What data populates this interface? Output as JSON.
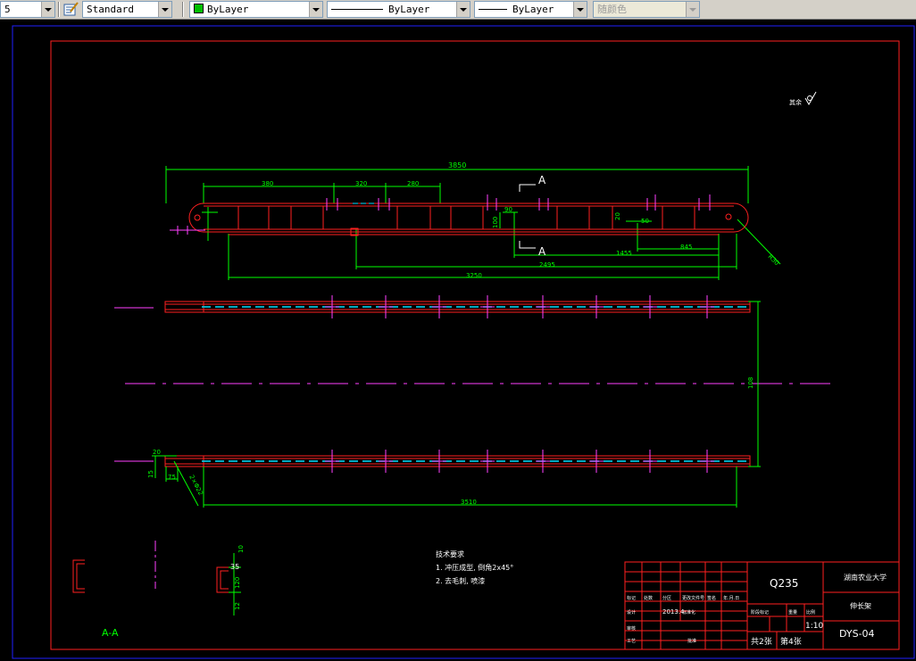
{
  "toolbar": {
    "layer_value": "5",
    "textstyle_value": "Standard",
    "color_value": "ByLayer",
    "linetype_value": "ByLayer",
    "lineweight_value": "ByLayer",
    "plotstyle_value": "随颜色",
    "colors": {
      "panel": "#d4d0c8",
      "green_swatch": "#00c000"
    }
  },
  "drawing": {
    "background": "#000000",
    "dims": {
      "overall": "3850",
      "d380": "380",
      "d320": "320",
      "d280": "280",
      "d100": "100",
      "d90": "90",
      "d20": "20",
      "d50": "50",
      "d845": "845",
      "d1455": "1455",
      "d2495": "2495",
      "d3250": "3250",
      "r": "R30",
      "d108": "108",
      "d20b": "20",
      "d15": "15",
      "d75": "75",
      "d2x8": "2×Φ22",
      "d3510": "3510",
      "d10": "10",
      "d35": "35",
      "d120": "120",
      "d12": "12"
    },
    "section_mark": "A",
    "section_label": "A-A",
    "roughness_label": "其余",
    "notes": {
      "title": "技术要求",
      "line1": "1. 冲压成型, 倒角2x45°",
      "line2": "2. 去毛刺, 喷漆"
    },
    "title_block": {
      "material": "Q235",
      "school": "湖南农业大学",
      "part_name": "伸长架",
      "drawing_no": "DYS-04",
      "scale": "1:10",
      "sheet_total": "共2张",
      "sheet_no": "第4张",
      "date": "2013.4",
      "lbl_mark": "标记",
      "lbl_count": "处数",
      "lbl_zone": "分区",
      "lbl_change": "更改文件号",
      "lbl_sign": "签名",
      "lbl_ymd": "年.月.日",
      "lbl_design": "设计",
      "lbl_std": "标准化",
      "lbl_stage": "阶段标记",
      "lbl_weight": "重量",
      "lbl_ratio": "比例",
      "lbl_check": "审核",
      "lbl_craft": "工艺",
      "lbl_approve": "批准"
    }
  }
}
